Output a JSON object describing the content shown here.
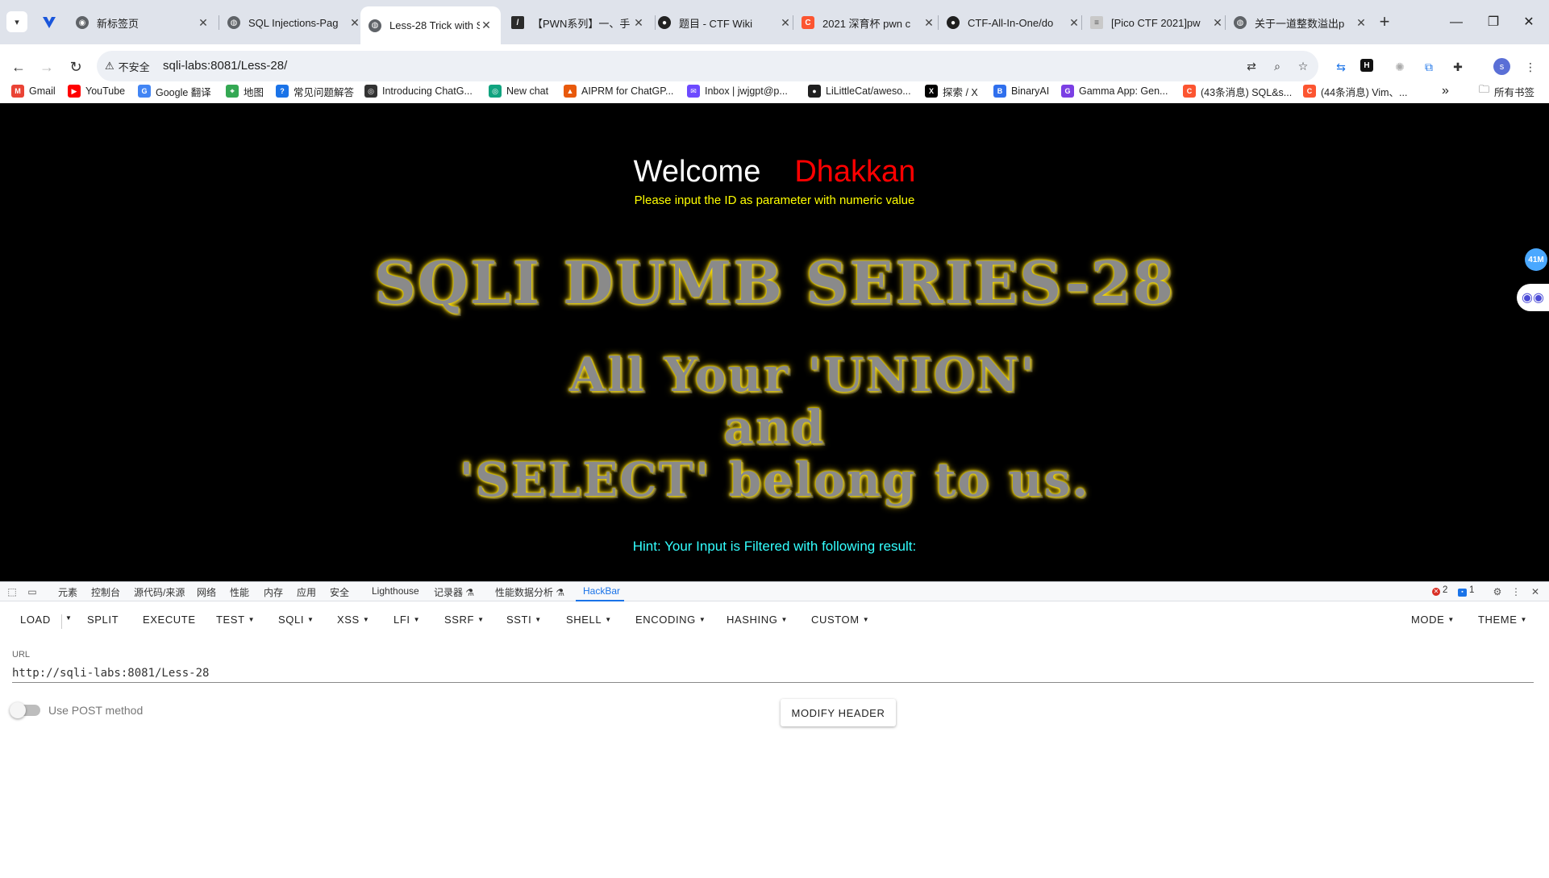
{
  "tabs": [
    {
      "title": "新标签页",
      "icon": "chrome-icon",
      "active": false
    },
    {
      "title": "SQL Injections-Pag",
      "icon": "globe-icon",
      "active": false
    },
    {
      "title": "Less-28 Trick with S",
      "icon": "globe-icon",
      "active": true
    },
    {
      "title": "【PWN系列】一、手",
      "icon": "slash-icon",
      "active": false
    },
    {
      "title": "题目 - CTF Wiki",
      "icon": "github-dark-icon",
      "active": false
    },
    {
      "title": "2021 深育杯 pwn c",
      "icon": "csdn-icon",
      "active": false
    },
    {
      "title": "CTF-All-In-One/do",
      "icon": "github-icon",
      "active": false
    },
    {
      "title": "[Pico CTF 2021]pw",
      "icon": "doc-icon",
      "active": false
    },
    {
      "title": "关于一道整数溢出p",
      "icon": "globe-icon",
      "active": false
    }
  ],
  "toolbar": {
    "security_label": "不安全",
    "url": "sqli-labs:8081/Less-28/",
    "profile_initial": "s"
  },
  "bookmarks": [
    {
      "label": "Gmail",
      "icon": "gmail-icon",
      "color": "#ea4335",
      "glyph": "M"
    },
    {
      "label": "YouTube",
      "icon": "youtube-icon",
      "color": "#ff0000",
      "glyph": "▶"
    },
    {
      "label": "Google 翻译",
      "icon": "translate-icon",
      "color": "#4285f4",
      "glyph": "G"
    },
    {
      "label": "地图",
      "icon": "maps-icon",
      "color": "#34a853",
      "glyph": "⌖"
    },
    {
      "label": "常见问题解答",
      "icon": "faq-icon",
      "color": "#1a73e8",
      "glyph": "?"
    },
    {
      "label": "Introducing ChatG...",
      "icon": "openai-icon",
      "color": "#333333",
      "glyph": "◎"
    },
    {
      "label": "New chat",
      "icon": "chatgpt-icon",
      "color": "#10a37f",
      "glyph": "◎"
    },
    {
      "label": "AIPRM for ChatGP...",
      "icon": "aiprm-icon",
      "color": "#e8590c",
      "glyph": "▲"
    },
    {
      "label": "Inbox | jwjgpt@p...",
      "icon": "mail-icon",
      "color": "#6d4aff",
      "glyph": "✉"
    },
    {
      "label": "LiLittleCat/aweso...",
      "icon": "github-icon",
      "color": "#1f1f1f",
      "glyph": "●"
    },
    {
      "label": "探索 / X",
      "icon": "x-icon",
      "color": "#000000",
      "glyph": "X"
    },
    {
      "label": "BinaryAI",
      "icon": "binaryai-icon",
      "color": "#2f6fed",
      "glyph": "B"
    },
    {
      "label": "Gamma App: Gen...",
      "icon": "gamma-icon",
      "color": "#7b3fe4",
      "glyph": "G"
    },
    {
      "label": "(43条消息) SQL&s...",
      "icon": "csdn-icon",
      "color": "#fc5531",
      "glyph": "C"
    },
    {
      "label": "(44条消息) Vim、...",
      "icon": "csdn-icon",
      "color": "#fc5531",
      "glyph": "C"
    }
  ],
  "bookmarks_more": "»",
  "all_bookmarks": "所有书签",
  "page": {
    "welcome": "Welcome",
    "user": "Dhakkan",
    "instruction": "Please input the ID as parameter with numeric value",
    "title_line": "SQLI DUMB SERIES-28",
    "slogan_1": "All Your 'UNION'",
    "slogan_2": "and",
    "slogan_3": "'SELECT' belong to us.",
    "hint": "Hint: Your Input is Filtered with following result:",
    "side_badge": "41M"
  },
  "devtools": {
    "tabs": [
      "元素",
      "控制台",
      "源代码/来源",
      "网络",
      "性能",
      "内存",
      "应用",
      "安全",
      "Lighthouse",
      "记录器 ⚗",
      "性能数据分析 ⚗",
      "HackBar"
    ],
    "active_tab": "HackBar",
    "errors": "2",
    "messages": "1"
  },
  "hackbar": {
    "buttons": [
      "LOAD",
      "SPLIT",
      "EXECUTE",
      "TEST",
      "SQLI",
      "XSS",
      "LFI",
      "SSRF",
      "SSTI",
      "SHELL",
      "ENCODING",
      "HASHING",
      "CUSTOM"
    ],
    "mode": "MODE",
    "theme": "THEME",
    "url_label": "URL",
    "url_value": "http://sqli-labs:8081/Less-28",
    "post_label": "Use POST method",
    "post_enabled": false,
    "modify_header": "MODIFY HEADER"
  }
}
